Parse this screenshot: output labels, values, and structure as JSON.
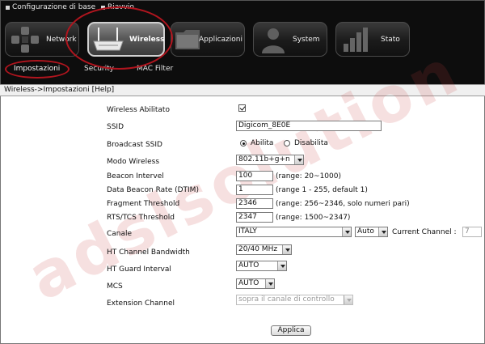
{
  "top_menu": {
    "config_label": "Configurazione di base",
    "reboot_label": "Riavvio"
  },
  "nav_tabs": [
    {
      "id": "network",
      "label": "Network",
      "icon": "network-cross-icon"
    },
    {
      "id": "wireless",
      "label": "Wireless",
      "icon": "wireless-router-icon"
    },
    {
      "id": "applicazioni",
      "label": "Applicazioni",
      "icon": "folder-icon"
    },
    {
      "id": "system",
      "label": "System",
      "icon": "user-icon"
    },
    {
      "id": "stato",
      "label": "Stato",
      "icon": "bar-chart-icon"
    }
  ],
  "active_nav": "Wireless",
  "sub_tabs": [
    "Impostazioni",
    "Security",
    "MAC Filter"
  ],
  "active_sub_tab": "Impostazioni",
  "breadcrumb": {
    "path": "Wireless->Impostazioni",
    "help": "[Help]"
  },
  "form": {
    "wireless_enabled": {
      "label": "Wireless Abilitato",
      "checked": true
    },
    "ssid": {
      "label": "SSID",
      "value": "Digicom_8E0E"
    },
    "broadcast_ssid": {
      "label": "Broadcast SSID",
      "option_on": "Abilita",
      "option_off": "Disabilita",
      "selected": "Abilita"
    },
    "modo_wireless": {
      "label": "Modo Wireless",
      "value": "802.11b+g+n"
    },
    "beacon_interval": {
      "label": "Beacon Intervel",
      "value": "100",
      "hint": "(range: 20~1000)"
    },
    "dtim": {
      "label": "Data Beacon Rate (DTIM)",
      "value": "1",
      "hint": "(range 1 - 255, default 1)"
    },
    "fragment": {
      "label": "Fragment Threshold",
      "value": "2346",
      "hint": "(range: 256~2346, solo numeri pari)"
    },
    "rts": {
      "label": "RTS/TCS Threshold",
      "value": "2347",
      "hint": "(range: 1500~2347)"
    },
    "canale": {
      "label": "Canale",
      "country": "ITALY",
      "channel": "Auto",
      "current_label": "Current Channel :",
      "current_value": "7"
    },
    "ht_bandwidth": {
      "label": "HT Channel Bandwidth",
      "value": "20/40 MHz"
    },
    "ht_guard": {
      "label": "HT Guard Interval",
      "value": "AUTO"
    },
    "mcs": {
      "label": "MCS",
      "value": "AUTO"
    },
    "extension_channel": {
      "label": "Extension Channel",
      "value": "sopra il canale di controllo"
    },
    "apply_label": "Applica"
  },
  "watermark": "adslsolution",
  "colors": {
    "highlight_circle": "#b0151e",
    "top_bar": "#0d0d0d",
    "watermark": "#c83c3c"
  }
}
